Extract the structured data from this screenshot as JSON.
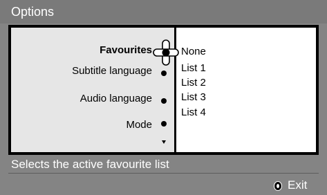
{
  "header": {
    "title": "Options"
  },
  "menu": {
    "items": [
      {
        "label": "Favourites",
        "selected": true
      },
      {
        "label": "Subtitle language",
        "selected": false
      },
      {
        "label": "Audio language",
        "selected": false
      },
      {
        "label": "Mode",
        "selected": false
      }
    ]
  },
  "options_list": {
    "items": [
      "None",
      "List 1",
      "List 2",
      "List 3",
      "List 4"
    ]
  },
  "status": {
    "help_text": "Selects the active favourite list"
  },
  "footer": {
    "exit_label": "Exit"
  },
  "colors": {
    "background": "#848484",
    "title_bar": "#7a7a7a",
    "left_panel": "#e6e6e6",
    "right_panel": "#ffffff",
    "frame": "#000000",
    "text_light": "#ffffff"
  }
}
